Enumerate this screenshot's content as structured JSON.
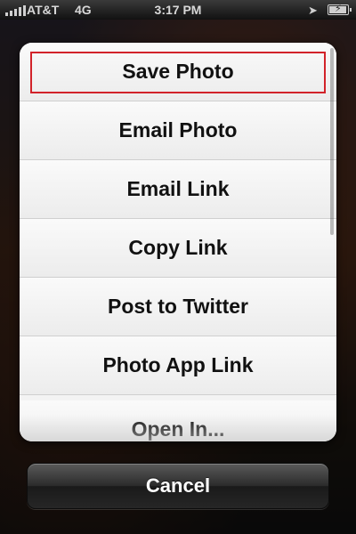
{
  "status_bar": {
    "carrier": "AT&T",
    "network": "4G",
    "time": "3:17 PM",
    "icons": [
      "signal-bars-icon",
      "location-arrow-icon",
      "battery-charging-icon"
    ]
  },
  "action_sheet": {
    "items": [
      {
        "label": "Save Photo",
        "highlighted": true
      },
      {
        "label": "Email Photo"
      },
      {
        "label": "Email Link"
      },
      {
        "label": "Copy Link"
      },
      {
        "label": "Post to Twitter"
      },
      {
        "label": "Photo App Link"
      },
      {
        "label": "Open In..."
      }
    ],
    "highlight_color": "#d2232a"
  },
  "cancel": {
    "label": "Cancel"
  }
}
